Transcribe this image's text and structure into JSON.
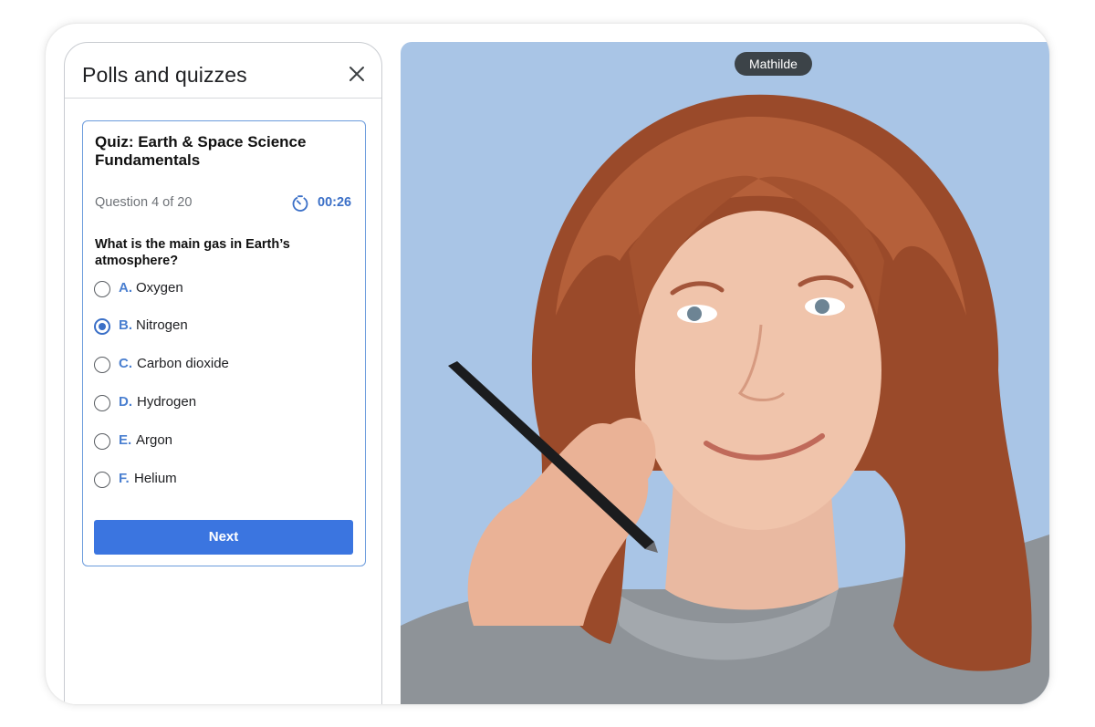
{
  "panel": {
    "title": "Polls and quizzes",
    "close_icon": "close-icon"
  },
  "quiz": {
    "title": "Quiz: Earth & Space Science Fundamentals",
    "progress": "Question 4 of 20",
    "timer_icon": "timer-icon",
    "timer": "00:26",
    "question": "What is the main gas in Earth’s atmosphere?",
    "options": [
      {
        "letter": "A.",
        "label": "Oxygen",
        "selected": false
      },
      {
        "letter": "B.",
        "label": "Nitrogen",
        "selected": true
      },
      {
        "letter": "C.",
        "label": "Carbon dioxide",
        "selected": false
      },
      {
        "letter": "D.",
        "label": "Hydrogen",
        "selected": false
      },
      {
        "letter": "E.",
        "label": "Argon",
        "selected": false
      },
      {
        "letter": "F.",
        "label": "Helium",
        "selected": false
      }
    ],
    "next_label": "Next"
  },
  "participant": {
    "name": "Mathilde"
  },
  "colors": {
    "accent": "#3b75e0",
    "accent_text": "#3a6fc7",
    "card_border": "#6b9bdc",
    "video_background": "#a9c5e6",
    "name_tag": "#3c4348"
  }
}
